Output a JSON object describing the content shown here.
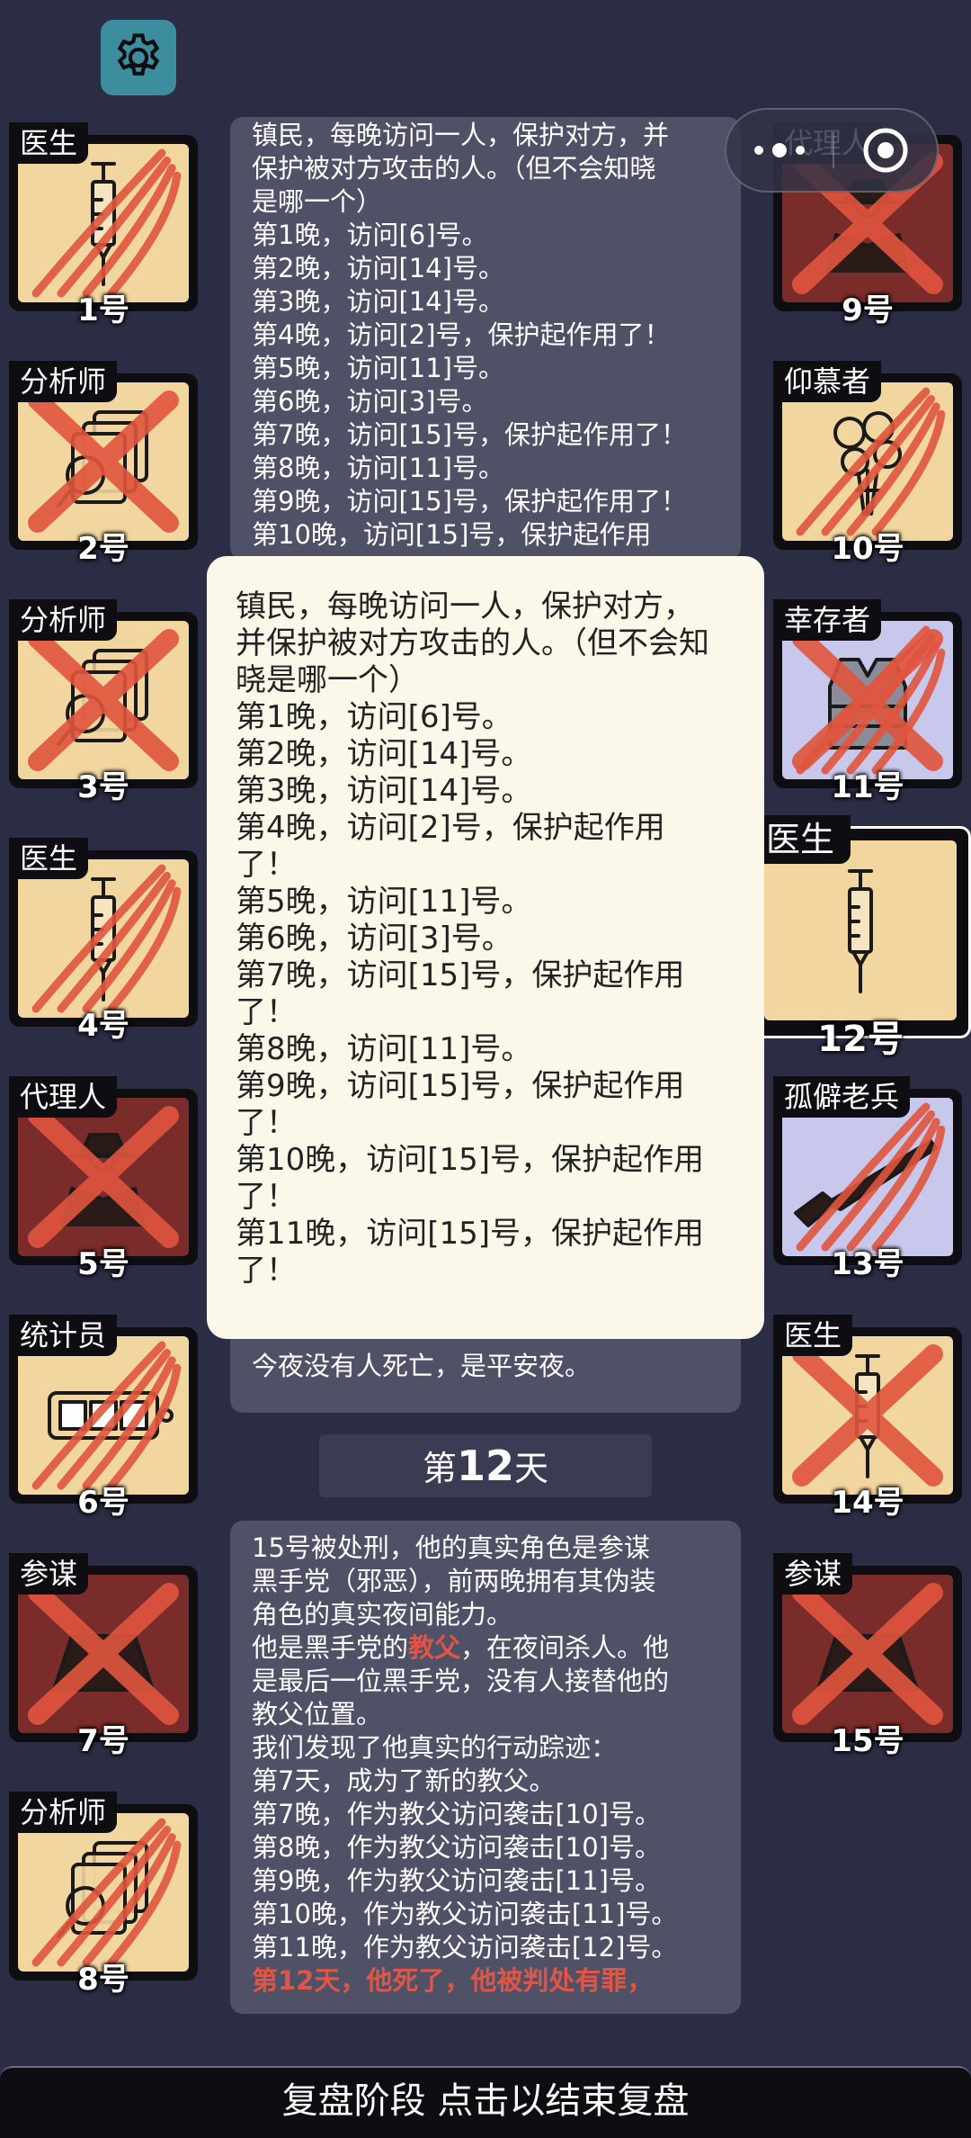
{
  "players_left": [
    {
      "role": "医生",
      "num": "1号",
      "bg": "yellow",
      "icon": "syringe-icon",
      "dead": false,
      "claw": true
    },
    {
      "role": "分析师",
      "num": "2号",
      "bg": "yellow",
      "icon": "magnifier-files-icon",
      "dead": true,
      "claw": false
    },
    {
      "role": "分析师",
      "num": "3号",
      "bg": "yellow",
      "icon": "magnifier-files-icon",
      "dead": true,
      "claw": false
    },
    {
      "role": "医生",
      "num": "4号",
      "bg": "yellow",
      "icon": "syringe-icon",
      "dead": false,
      "claw": true
    },
    {
      "role": "代理人",
      "num": "5号",
      "bg": "red",
      "icon": "agent-icon",
      "dead": true,
      "claw": false
    },
    {
      "role": "统计员",
      "num": "6号",
      "bg": "yellow",
      "icon": "counter-icon",
      "dead": false,
      "claw": true
    },
    {
      "role": "参谋",
      "num": "7号",
      "bg": "red",
      "icon": "strategist-icon",
      "dead": true,
      "claw": false
    },
    {
      "role": "分析师",
      "num": "8号",
      "bg": "yellow",
      "icon": "magnifier-files-icon",
      "dead": false,
      "claw": true
    }
  ],
  "players_right": [
    {
      "role": "代理人",
      "num": "9号",
      "bg": "red",
      "icon": "agent-icon",
      "dead": true,
      "claw": false
    },
    {
      "role": "仰慕者",
      "num": "10号",
      "bg": "yellow",
      "icon": "flowers-icon",
      "dead": false,
      "claw": true
    },
    {
      "role": "幸存者",
      "num": "11号",
      "bg": "blue",
      "icon": "vest-icon",
      "dead": true,
      "claw": true
    },
    {
      "role": "医生",
      "num": "12号",
      "bg": "yellow",
      "icon": "syringe-icon",
      "dead": false,
      "claw": false,
      "highlight": true
    },
    {
      "role": "孤僻老兵",
      "num": "13号",
      "bg": "blue",
      "icon": "rifle-icon",
      "dead": false,
      "claw": true
    },
    {
      "role": "医生",
      "num": "14号",
      "bg": "yellow",
      "icon": "syringe-icon",
      "dead": true,
      "claw": false
    },
    {
      "role": "参谋",
      "num": "15号",
      "bg": "red",
      "icon": "strategist-icon",
      "dead": true,
      "claw": false
    }
  ],
  "log_top": [
    "镇民，每晚访问一人，保护对方，并",
    "保护被对方攻击的人。（但不会知晓",
    "是哪一个）",
    "第1晚，访问[6]号。",
    "第2晚，访问[14]号。",
    "第3晚，访问[14]号。",
    "第4晚，访问[2]号，保护起作用了！",
    "第5晚，访问[11]号。",
    "第6晚，访问[3]号。",
    "第7晚，访问[15]号，保护起作用了！",
    "第8晚，访问[11]号。",
    "第9晚，访问[15]号，保护起作用了！",
    "第10晚，访问[15]号，保护起作用"
  ],
  "peace_text": "今夜没有人死亡，是平安夜。",
  "day": {
    "prefix": "第",
    "number": "12",
    "suffix": "天"
  },
  "log_bottom": [
    {
      "parts": [
        {
          "t": "15号被处刑，他的真实角色是参谋",
          "c": ""
        }
      ]
    },
    {
      "parts": [
        {
          "t": "黑手党（邪恶），前两晚拥有其伪装",
          "c": ""
        }
      ]
    },
    {
      "parts": [
        {
          "t": "角色的真实夜间能力。",
          "c": ""
        }
      ]
    },
    {
      "parts": [
        {
          "t": "他是黑手党的",
          "c": ""
        },
        {
          "t": "教父",
          "c": "red"
        },
        {
          "t": "，在夜间杀人。他",
          "c": ""
        }
      ]
    },
    {
      "parts": [
        {
          "t": "是最后一位黑手党，没有人接替他的",
          "c": ""
        }
      ]
    },
    {
      "parts": [
        {
          "t": "教父位置。",
          "c": ""
        }
      ]
    },
    {
      "parts": [
        {
          "t": "我们发现了他真实的行动踪迹：",
          "c": ""
        }
      ]
    },
    {
      "parts": [
        {
          "t": "第7天，成为了新的教父。",
          "c": ""
        }
      ]
    },
    {
      "parts": [
        {
          "t": "第7晚，作为教父访问袭击[10]号。",
          "c": ""
        }
      ]
    },
    {
      "parts": [
        {
          "t": "第8晚，作为教父访问袭击[10]号。",
          "c": ""
        }
      ]
    },
    {
      "parts": [
        {
          "t": "第9晚，作为教父访问袭击[11]号。",
          "c": ""
        }
      ]
    },
    {
      "parts": [
        {
          "t": "第10晚，作为教父访问袭击[11]号。",
          "c": ""
        }
      ]
    },
    {
      "parts": [
        {
          "t": "第11晚，作为教父访问袭击[12]号。",
          "c": ""
        }
      ]
    },
    {
      "parts": [
        {
          "t": "第12天，他死了，他被判处有罪，",
          "c": "red"
        }
      ]
    }
  ],
  "popup_lines": [
    "镇民，每晚访问一人，保护对方，",
    "并保护被对方攻击的人。（但不会知",
    "晓是哪一个）",
    "第1晚，访问[6]号。",
    "第2晚，访问[14]号。",
    "第3晚，访问[14]号。",
    "第4晚，访问[2]号，保护起作用",
    "了！",
    "第5晚，访问[11]号。",
    "第6晚，访问[3]号。",
    "第7晚，访问[15]号，保护起作用",
    "了！",
    "第8晚，访问[11]号。",
    "第9晚，访问[15]号，保护起作用",
    "了！",
    "第10晚，访问[15]号，保护起作用",
    "了！",
    "第11晚，访问[15]号，保护起作用",
    "了！"
  ],
  "bottom_bar": "复盘阶段 点击以结束复盘",
  "colors": {
    "background": "#2b2d44",
    "card_yellow": "#f2d6a0",
    "card_red": "#7a2c2a",
    "card_blue": "#c7c8ec",
    "claw": "#e0553e",
    "highlight_red": "#e05545",
    "popup_bg": "#fbf8ea"
  }
}
